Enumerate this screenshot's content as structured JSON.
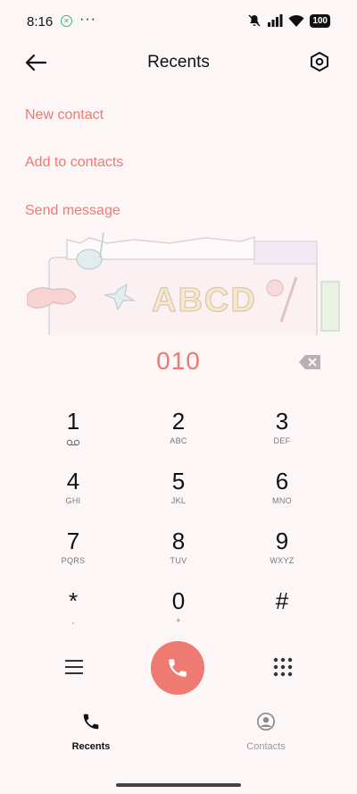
{
  "status": {
    "time": "8:16",
    "battery": "100"
  },
  "header": {
    "title": "Recents"
  },
  "actions": {
    "new_contact": "New contact",
    "add_to_contacts": "Add to contacts",
    "send_message": "Send message"
  },
  "illustration": {
    "text": "ABCD"
  },
  "dialer": {
    "number": "010",
    "keys": [
      {
        "digit": "1",
        "letters": ""
      },
      {
        "digit": "2",
        "letters": "ABC"
      },
      {
        "digit": "3",
        "letters": "DEF"
      },
      {
        "digit": "4",
        "letters": "GHI"
      },
      {
        "digit": "5",
        "letters": "JKL"
      },
      {
        "digit": "6",
        "letters": "MNO"
      },
      {
        "digit": "7",
        "letters": "PQRS"
      },
      {
        "digit": "8",
        "letters": "TUV"
      },
      {
        "digit": "9",
        "letters": "WXYZ"
      },
      {
        "digit": "*",
        "letters": ","
      },
      {
        "digit": "0",
        "letters": "+"
      },
      {
        "digit": "#",
        "letters": ""
      }
    ]
  },
  "nav": {
    "recents": "Recents",
    "contacts": "Contacts"
  },
  "colors": {
    "accent": "#ee7a72",
    "background": "#fcf6f7"
  }
}
